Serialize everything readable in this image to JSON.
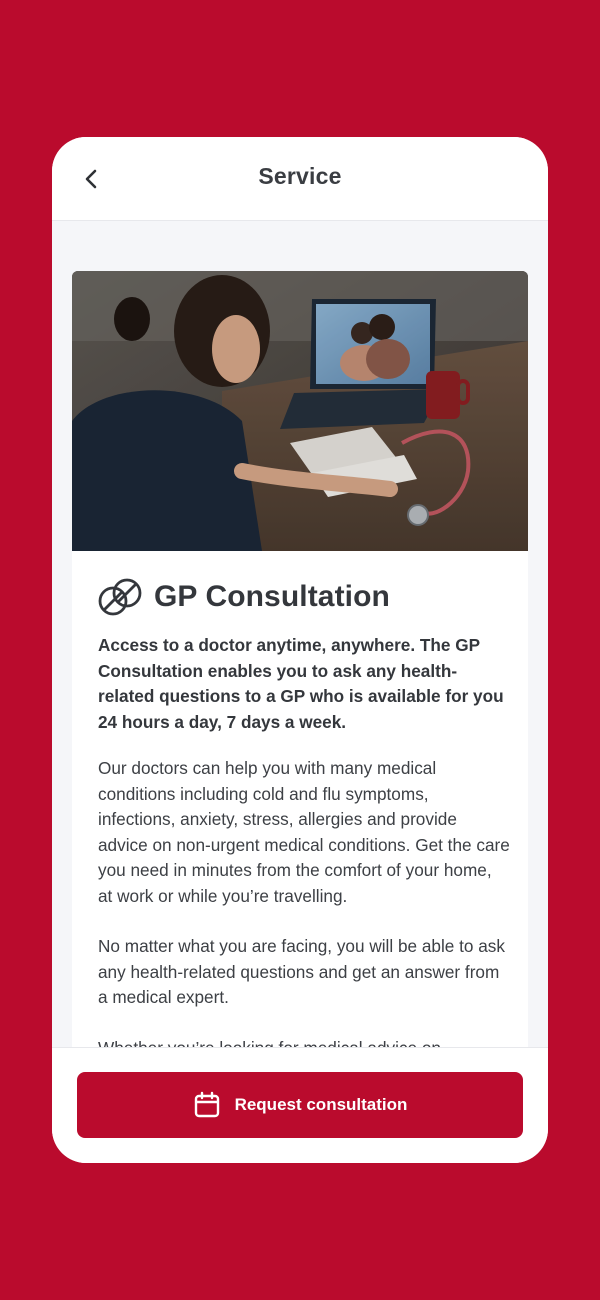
{
  "app": {
    "background_color": "#BA0B2D",
    "accent_color": "#BA0B2D"
  },
  "header": {
    "title": "Service",
    "back_icon": "chevron-left-icon"
  },
  "service": {
    "icon": "pills-icon",
    "title": "GP Consultation",
    "intro": "Access to a doctor anytime, anywhere. The GP Consultation enables you to ask any health-related questions to a GP who is available for you 24 hours a day, 7 days a week.",
    "paragraph_1": "Our doctors can help you with many medical conditions including cold and flu symptoms, infections, anxiety, stress, allergies and provide advice on non-urgent medical conditions. Get the care you need in minutes from the comfort of your home, at work or while you’re travelling.",
    "paragraph_2": "No matter what you are facing, you will be able to ask any health-related questions and get an answer from a medical expert.",
    "paragraph_3_partial": "Whether you’re looking for medical advice on"
  },
  "footer": {
    "cta_label": "Request consultation",
    "cta_icon": "calendar-icon"
  }
}
